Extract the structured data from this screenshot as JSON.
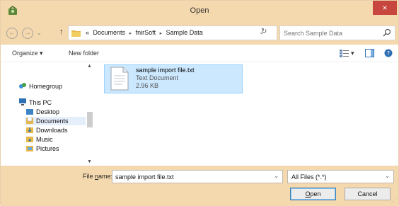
{
  "window": {
    "title": "Open",
    "close_glyph": "×"
  },
  "address": {
    "collapse_marker": "«",
    "crumbs": [
      "Documents",
      "fnirSoft",
      "Sample Data"
    ],
    "separator": "▸",
    "dropdown_glyph": "⌄",
    "refresh_glyph": "↻"
  },
  "search": {
    "placeholder": "Search Sample Data"
  },
  "toolbar": {
    "organize_label": "Organize ▾",
    "new_folder_label": "New folder",
    "view_drop": "▾"
  },
  "nav": {
    "homegroup": "Homegroup",
    "this_pc": "This PC",
    "items": [
      "Desktop",
      "Documents",
      "Downloads",
      "Music",
      "Pictures"
    ],
    "scroll_up": "▲",
    "scroll_down": "▼"
  },
  "file": {
    "name": "sample import file.txt",
    "type": "Text Document",
    "size": "2.96 KB"
  },
  "bottom": {
    "file_name_label_prefix": "File ",
    "file_name_label_ul": "n",
    "file_name_label_suffix": "ame:",
    "file_name_value": "sample import file.txt",
    "filter_value": "All Files (*.*)",
    "open_ul": "O",
    "open_rest": "pen",
    "cancel_label": "Cancel",
    "drop_glyph": "⌄",
    "grip": "⋰"
  },
  "colors": {
    "chrome": "#f4d8ae",
    "close": "#c7463d",
    "selection": "#cce8ff"
  },
  "icons": [
    "app-icon",
    "back-icon",
    "forward-icon",
    "up-arrow-icon",
    "folder-icon",
    "refresh-icon",
    "search-icon",
    "view-icon",
    "pane-icon",
    "help-icon",
    "homegroup-icon",
    "pc-icon",
    "document-icon",
    "close-icon"
  ]
}
